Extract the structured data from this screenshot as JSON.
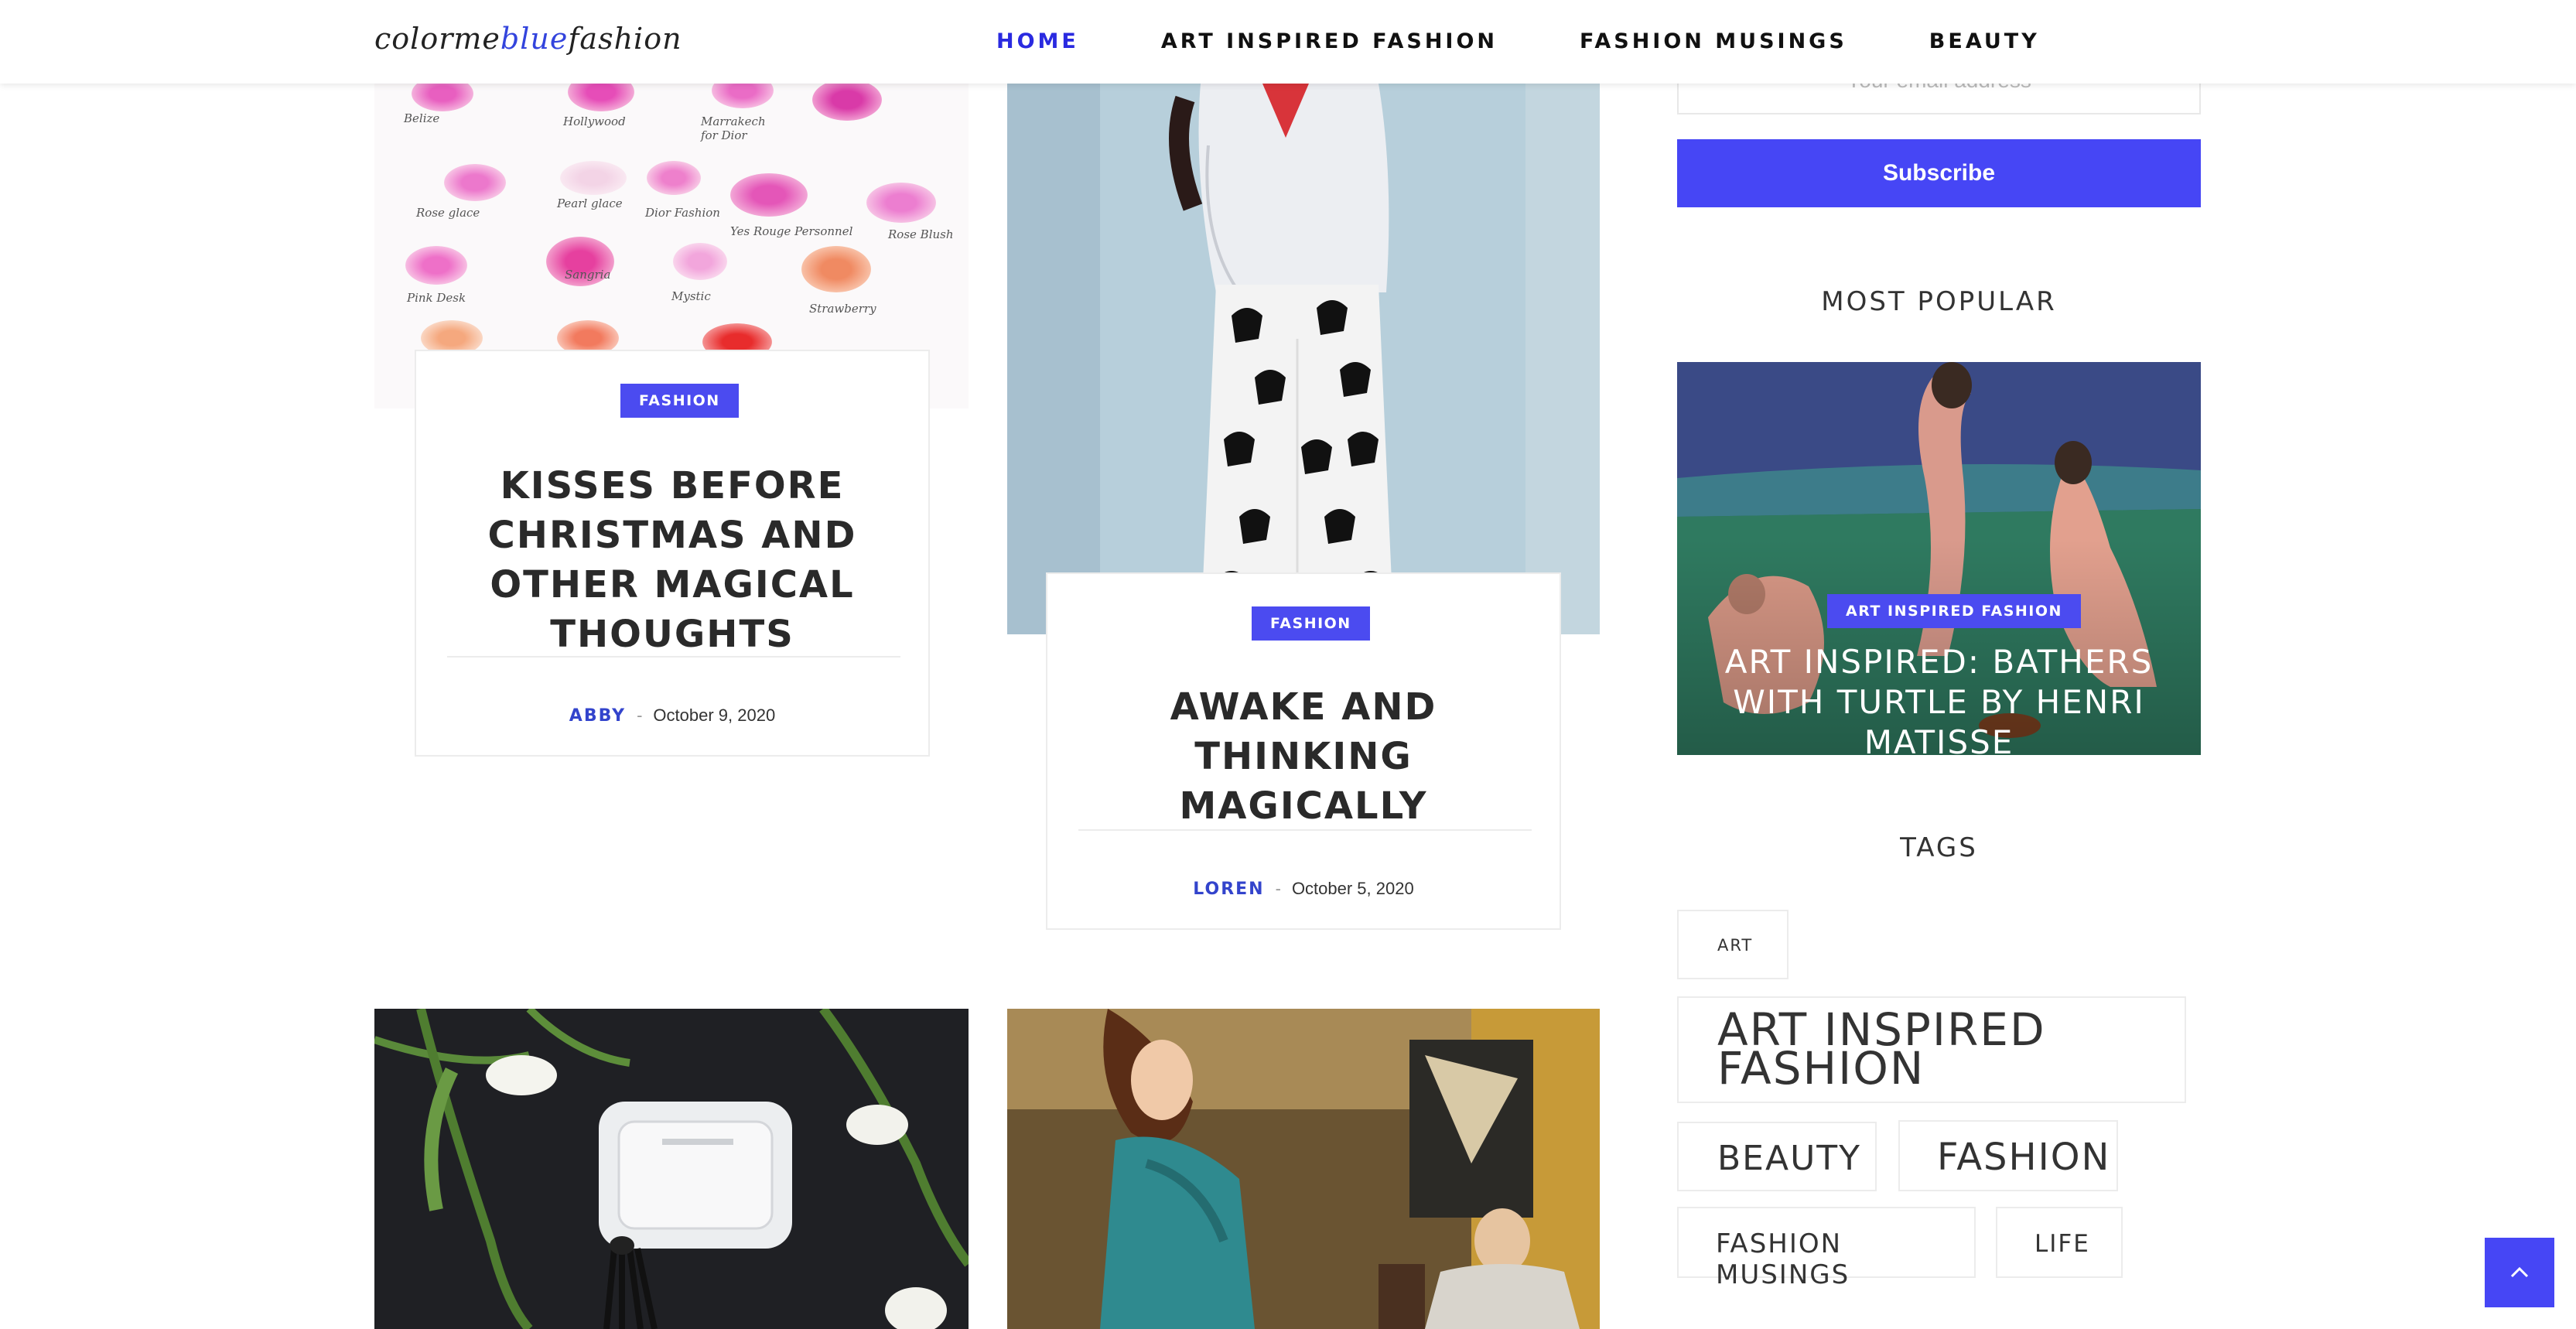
{
  "header": {
    "logo": {
      "part1": "colorme",
      "part2": "blue",
      "part3": "fashion"
    },
    "nav": [
      {
        "label": "HOME"
      },
      {
        "label": "ART INSPIRED FASHION"
      },
      {
        "label": "FASHION MUSINGS"
      },
      {
        "label": "BEAUTY"
      }
    ]
  },
  "posts": [
    {
      "category": "FASHION",
      "title": "KISSES BEFORE CHRISTMAS AND OTHER MAGICAL THOUGHTS",
      "author": "ABBY",
      "sep": "-",
      "date": "October 9, 2020"
    },
    {
      "category": "FASHION",
      "title": "AWAKE AND THINKING MAGICALLY",
      "author": "LOREN",
      "sep": "-",
      "date": "October 5, 2020"
    }
  ],
  "kiss_labels": [
    "Belize",
    "Hollywood",
    "Marrakech for Dior",
    "Rose glace",
    "Pearl glace",
    "Dior Fashion",
    "Yes Rouge Personnel",
    "Rose Blush",
    "Pink Desk",
    "Sangria",
    "Mystic",
    "Strawberry"
  ],
  "sidebar": {
    "email_placeholder": "Your email address",
    "subscribe_label": "Subscribe",
    "most_popular_heading": "MOST POPULAR",
    "popular": {
      "category": "ART INSPIRED FASHION",
      "title": "ART INSPIRED: BATHERS WITH TURTLE BY HENRI MATISSE"
    },
    "tags_heading": "TAGS",
    "tags": [
      "ART",
      "ART INSPIRED FASHION",
      "BEAUTY",
      "FASHION",
      "FASHION MUSINGS",
      "LIFE"
    ]
  },
  "colors": {
    "accent": "#4646f5",
    "nav_active": "#2a2ae0"
  },
  "icons": {
    "back_to_top": "chevron-up-icon"
  }
}
